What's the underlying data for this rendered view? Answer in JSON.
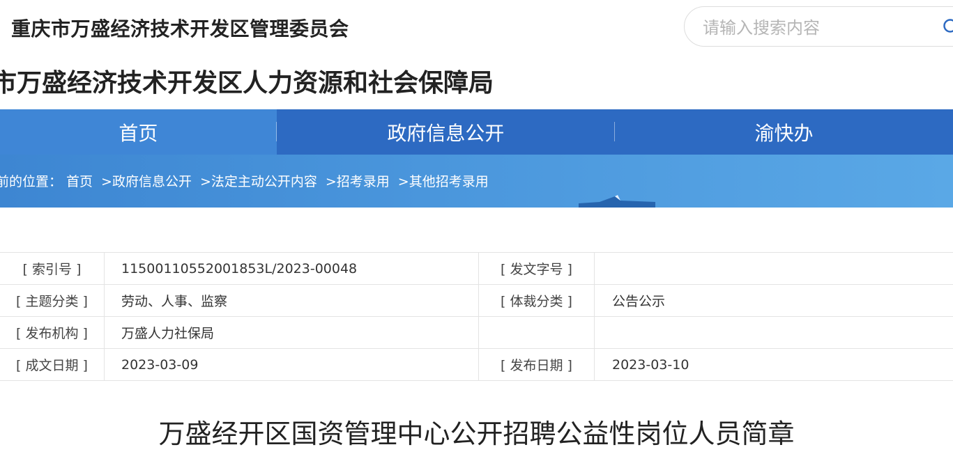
{
  "header": {
    "org_name": "重庆市万盛经济技术开发区管理委员会",
    "search_placeholder": "请输入搜索内容",
    "bureau_name": "市万盛经济技术开发区人力资源和社会保障局"
  },
  "nav": {
    "items": [
      {
        "label": "首页",
        "active": true
      },
      {
        "label": "政府信息公开",
        "active": false
      },
      {
        "label": "渝快办",
        "active": false
      }
    ]
  },
  "breadcrumb": {
    "prefix": "前的位置：",
    "items": [
      "首页",
      ">政府信息公开",
      ">法定主动公开内容",
      ">招考录用",
      ">其他招考录用"
    ]
  },
  "meta": {
    "rows": [
      {
        "k1": "[ 索引号 ]",
        "v1": "11500110552001853L/2023-00048",
        "k2": "[ 发文字号 ]",
        "v2": ""
      },
      {
        "k1": "[ 主题分类 ]",
        "v1": "劳动、人事、监察",
        "k2": "[ 体裁分类 ]",
        "v2": "公告公示"
      },
      {
        "k1": "[ 发布机构 ]",
        "v1": "万盛人力社保局",
        "k2": "",
        "v2": ""
      },
      {
        "k1": "[ 成文日期 ]",
        "v1": "2023-03-09",
        "k2": "[ 发布日期 ]",
        "v2": "2023-03-10"
      }
    ]
  },
  "article": {
    "title": "万盛经开区国资管理中心公开招聘公益性岗位人员简章"
  },
  "colors": {
    "nav_bg": "#2d6ac2",
    "nav_active": "#3f86d6",
    "banner": "#4a96dc"
  }
}
